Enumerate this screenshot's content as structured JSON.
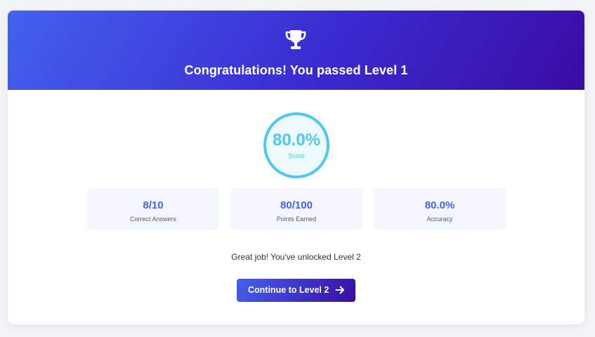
{
  "header": {
    "icon": "trophy-icon",
    "title": "Congratulations! You passed Level 1"
  },
  "score": {
    "value": "80.0%",
    "label": "Score",
    "percent": 80.0
  },
  "stats": [
    {
      "value": "8/10",
      "label": "Correct Answers"
    },
    {
      "value": "80/100",
      "label": "Points Earned"
    },
    {
      "value": "80.0%",
      "label": "Accuracy"
    }
  ],
  "message": "Great job! You've unlocked Level 2",
  "continue_button": {
    "label": "Continue to Level 2",
    "icon": "arrow-right-icon"
  },
  "colors": {
    "header_gradient_start": "#4361ee",
    "header_gradient_end": "#3a0ca3",
    "score_accent": "#4cc9f0",
    "stat_value": "#4361ee",
    "stat_background": "#f4f6fe"
  }
}
